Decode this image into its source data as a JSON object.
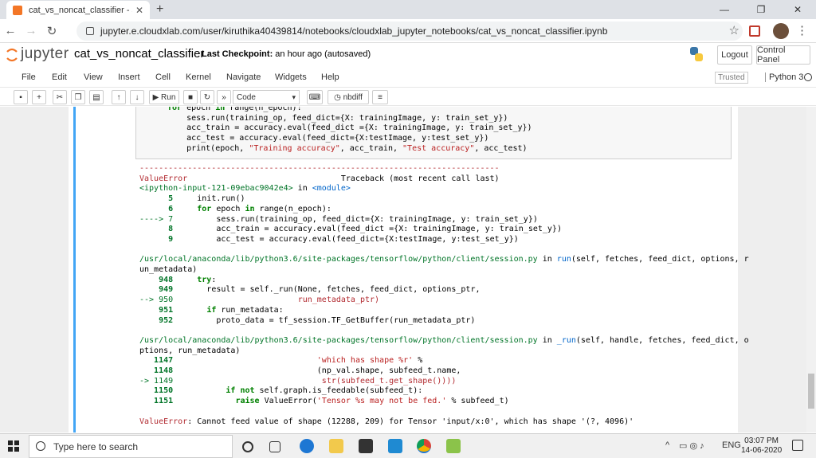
{
  "browser": {
    "tab_title": "cat_vs_noncat_classifier - Jupyter",
    "tab_close": "✕",
    "new_tab": "+",
    "url": "jupyter.e.cloudxlab.com/user/kiruthika40439814/notebooks/cloudxlab_jupyter_notebooks/cat_vs_noncat_classifier.ipynb",
    "window_buttons": [
      "—",
      "❐",
      "✕"
    ]
  },
  "header": {
    "logo_text": "jupyter",
    "notebook_name": "cat_vs_noncat_classifier",
    "checkpoint_label": "Last Checkpoint:",
    "checkpoint_time": "an hour ago",
    "autosave": "(autosaved)",
    "logout": "Logout",
    "control_panel": "Control Panel"
  },
  "menu": {
    "items": [
      "File",
      "Edit",
      "View",
      "Insert",
      "Cell",
      "Kernel",
      "Navigate",
      "Widgets",
      "Help"
    ],
    "trusted": "Trusted",
    "kernel_name": "Python 3"
  },
  "toolbar": {
    "run_label": "Run",
    "cell_type": "Code",
    "nbdiff": "nbdiff"
  },
  "taskbar": {
    "search_placeholder": "Type here to search",
    "lang": "ENG",
    "time": "03:07 PM",
    "date": "14-06-2020"
  },
  "accent_colors": {
    "cell_border": "#42a5f5",
    "error_red": "#b22b31",
    "jupyter_orange": "#f37626"
  }
}
